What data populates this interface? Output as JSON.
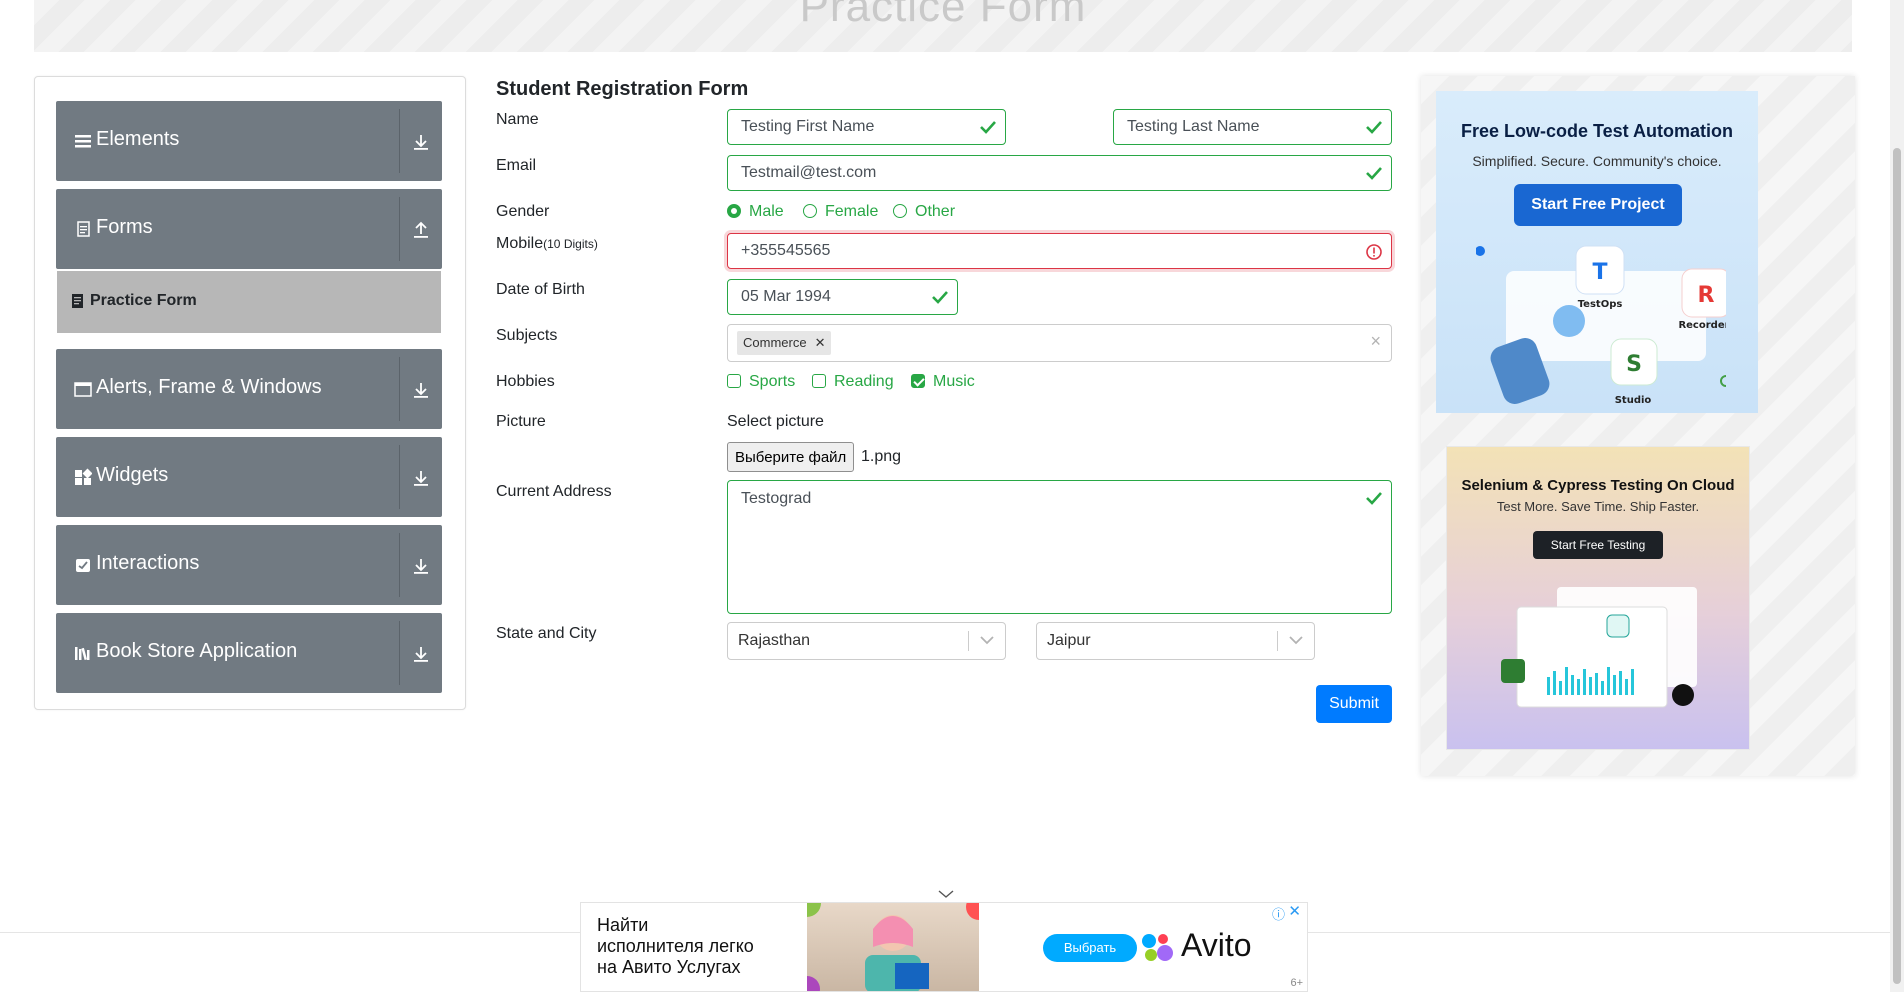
{
  "header": {
    "title": "Practice Form"
  },
  "sidebar": {
    "groups": [
      {
        "label": "Elements"
      },
      {
        "label": "Forms"
      },
      {
        "label": "Alerts, Frame & Windows"
      },
      {
        "label": "Widgets"
      },
      {
        "label": "Interactions"
      },
      {
        "label": "Book Store Application"
      }
    ],
    "active_item": "Practice Form"
  },
  "form": {
    "title": "Student Registration Form",
    "labels": {
      "name": "Name",
      "email": "Email",
      "gender": "Gender",
      "mobile": "Mobile",
      "mobile_hint": "(10 Digits)",
      "dob": "Date of Birth",
      "subjects": "Subjects",
      "hobbies": "Hobbies",
      "picture": "Picture",
      "address": "Current Address",
      "state_city": "State and City"
    },
    "first_name": "Testing First Name",
    "last_name": "Testing Last Name",
    "email": "Testmail@test.com",
    "gender_options": [
      "Male",
      "Female",
      "Other"
    ],
    "gender_selected": "Male",
    "mobile": "+355545565",
    "dob": "05 Mar 1994",
    "subjects": [
      "Commerce"
    ],
    "hobbies": [
      {
        "label": "Sports",
        "checked": false
      },
      {
        "label": "Reading",
        "checked": false
      },
      {
        "label": "Music",
        "checked": true
      }
    ],
    "picture_caption": "Select picture",
    "file_button": "Выберите файл",
    "file_name": "1.png",
    "address": "Testograd",
    "state": "Rajasthan",
    "city": "Jaipur",
    "submit": "Submit"
  },
  "ads": {
    "ad1": {
      "heading": "Free Low-code Test Automation",
      "sub": "Simplified. Secure. Community's choice.",
      "button": "Start Free Project",
      "products": [
        "TestOps",
        "Recorder",
        "Studio"
      ]
    },
    "ad2": {
      "heading": "Selenium & Cypress Testing On Cloud",
      "sub": "Test More. Save Time. Ship Faster.",
      "button": "Start Free Testing"
    },
    "bottom": {
      "line1": "Найти",
      "line2": "исполнителя легко",
      "line3": "на Авито Услугах",
      "cta": "Выбрать",
      "brand": "Avito",
      "age": "6+"
    }
  },
  "colors": {
    "valid": "#28a745",
    "invalid": "#dc3545",
    "primary": "#007bff",
    "sidebar": "#717a82"
  }
}
